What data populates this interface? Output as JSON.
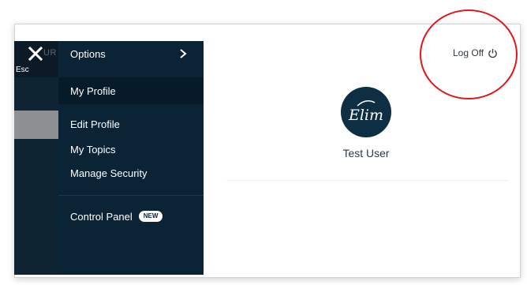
{
  "strip": {
    "close_label": "Esc",
    "fragment": "UR"
  },
  "menu": {
    "options_label": "Options",
    "items": [
      {
        "label": "My Profile",
        "selected": true
      },
      {
        "label": "Edit Profile"
      },
      {
        "label": "My Topics"
      },
      {
        "label": "Manage Security"
      }
    ],
    "control_panel_label": "Control Panel",
    "new_badge": "NEW"
  },
  "header": {
    "logoff_label": "Log Off"
  },
  "profile": {
    "avatar_text": "Elim",
    "username": "Test User"
  },
  "icons": {
    "close": "close-icon",
    "chevron": "chevron-right-icon",
    "power": "power-icon"
  },
  "colors": {
    "menu_bg": "#0a2436",
    "selected_bg": "#061a28",
    "avatar_bg": "#0e2f43",
    "highlight": "#e0161b"
  }
}
